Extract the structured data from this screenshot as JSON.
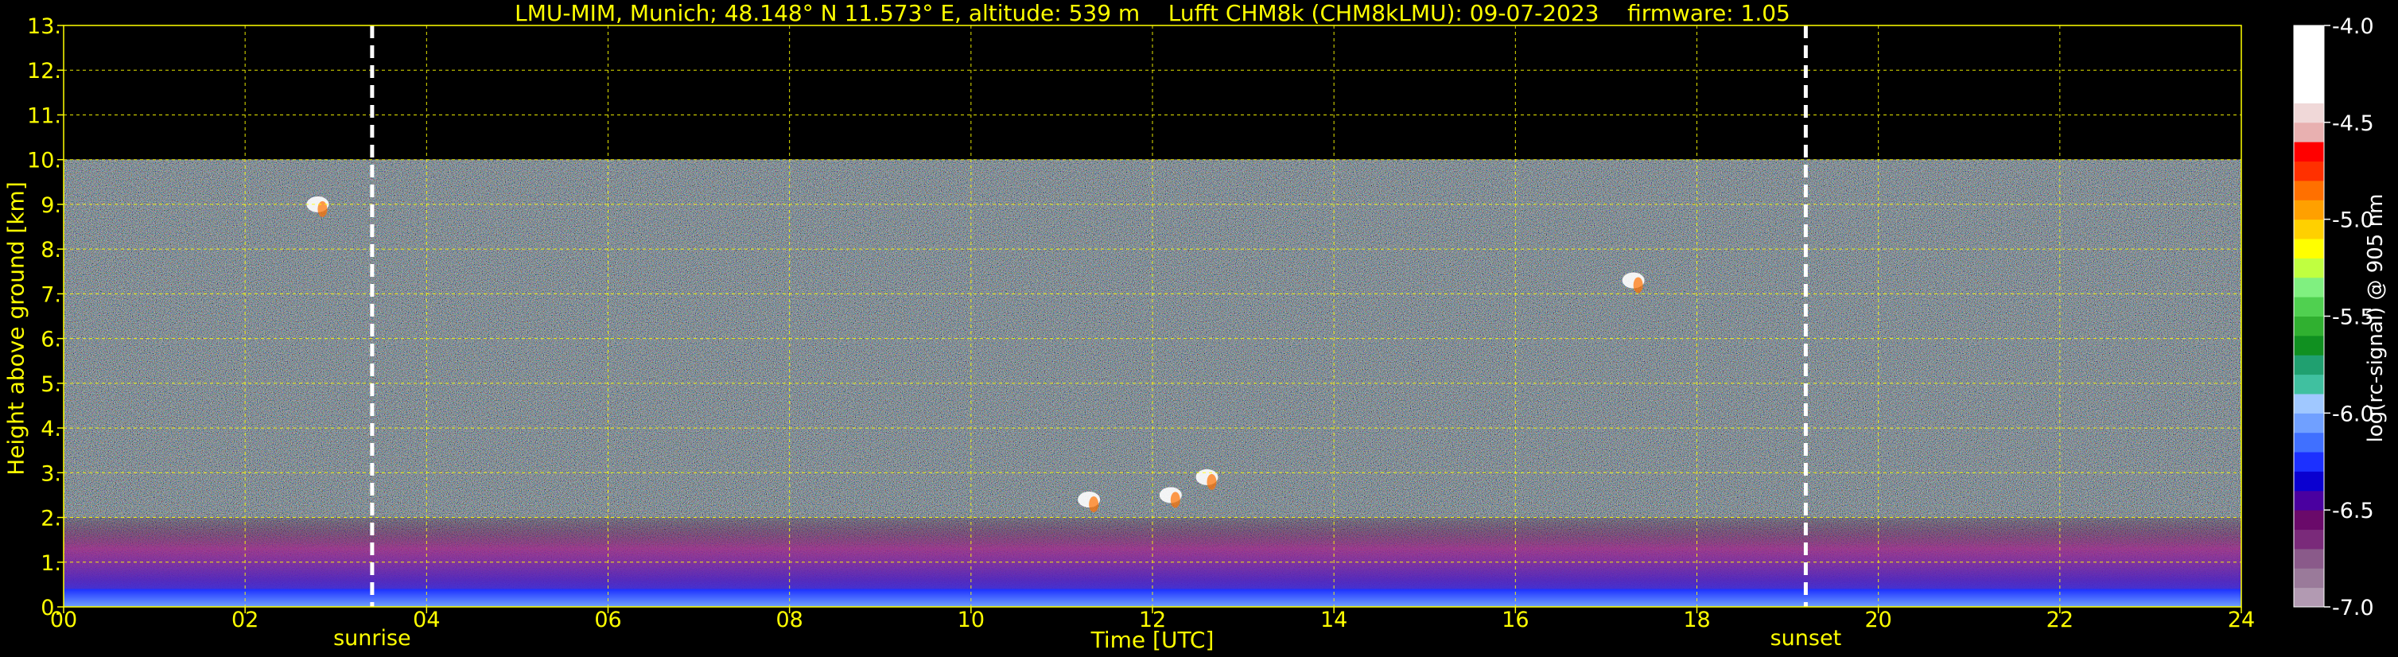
{
  "chart_data": {
    "type": "heatmap",
    "title": "LMU-MIM, Munich; 48.148° N 11.573° E, altitude: 539 m    Lufft CHM8k (CHM8kLMU): 09-07-2023    firmware: 1.05",
    "xlabel": "Time [UTC]",
    "ylabel": "Height above ground [km]",
    "xlim": [
      0,
      24
    ],
    "ylim": [
      0,
      13
    ],
    "x_ticks": [
      "00",
      "02",
      "04",
      "06",
      "08",
      "10",
      "12",
      "14",
      "16",
      "18",
      "20",
      "22",
      "24"
    ],
    "y_ticks": [
      "0.",
      "1.",
      "2.",
      "3.",
      "4.",
      "5.",
      "6.",
      "7.",
      "8.",
      "9.",
      "10.",
      "11.",
      "12.",
      "13."
    ],
    "grid": true,
    "data_top_km": 10,
    "markers": [
      {
        "label": "sunrise",
        "x": 3.4
      },
      {
        "label": "sunset",
        "x": 19.2
      }
    ],
    "colorbar": {
      "label": "log(rc-signal) @ 905 nm",
      "range": [
        -7.0,
        -4.0
      ],
      "ticks": [
        "-4.0",
        "-4.5",
        "-5.0",
        "-5.5",
        "-6.0",
        "-6.5",
        "-7.0"
      ],
      "colors": [
        "#b29ab2",
        "#9a7a9a",
        "#8a5a8a",
        "#7a2a7a",
        "#6a0a6a",
        "#4a00a0",
        "#0a00d0",
        "#1c30ff",
        "#4070ff",
        "#70a0ff",
        "#a0c8ff",
        "#40c0a0",
        "#20a070",
        "#109020",
        "#30b030",
        "#50d050",
        "#80f080",
        "#c0ff40",
        "#ffff00",
        "#ffd000",
        "#ffa000",
        "#ff7000",
        "#ff3000",
        "#ff0000",
        "#e8b0b0",
        "#f0d8d8",
        "#ffffff",
        "#ffffff",
        "#ffffff",
        "#ffffff"
      ]
    },
    "features": [
      {
        "kind": "aerosol_layer",
        "x_start": 0,
        "x_end": 24,
        "y_start": 0.0,
        "y_end": 2.0
      },
      {
        "kind": "cloud",
        "x": 2.8,
        "y": 9.0
      },
      {
        "kind": "cloud",
        "x": 11.3,
        "y": 2.4
      },
      {
        "kind": "cloud",
        "x": 12.2,
        "y": 2.5
      },
      {
        "kind": "cloud",
        "x": 12.6,
        "y": 2.9
      },
      {
        "kind": "cloud",
        "x": 17.3,
        "y": 7.3
      }
    ]
  }
}
